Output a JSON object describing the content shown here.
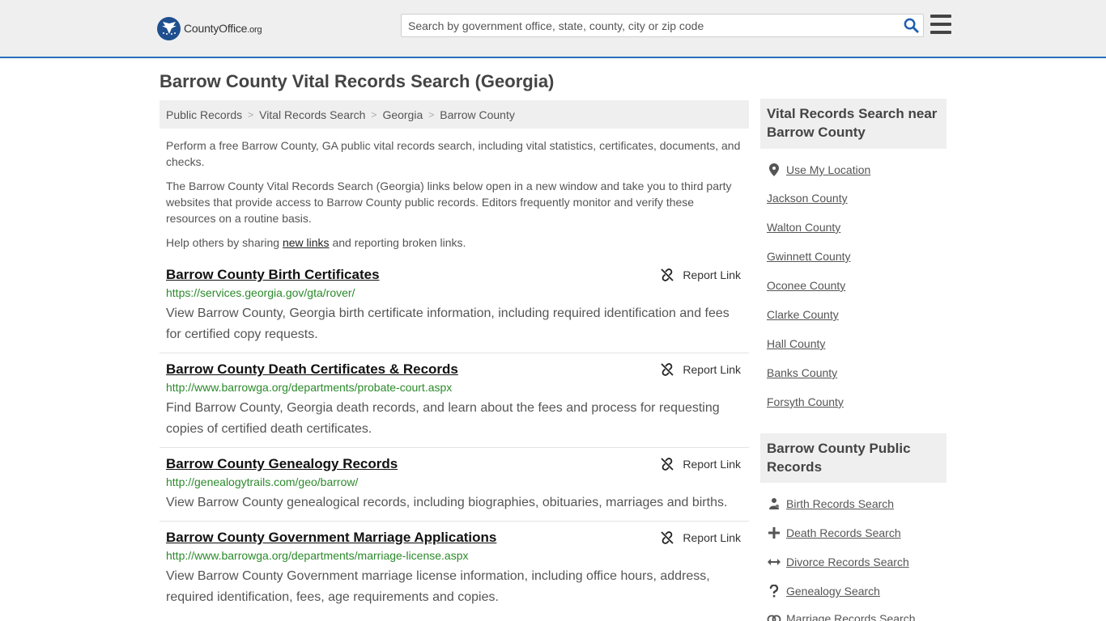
{
  "header": {
    "logo_text": "CountyOffice",
    "logo_tld": ".org",
    "search_placeholder": "Search by government office, state, county, city or zip code"
  },
  "page_title": "Barrow County Vital Records Search (Georgia)",
  "breadcrumb": [
    "Public Records",
    "Vital Records Search",
    "Georgia",
    "Barrow County"
  ],
  "intro": {
    "p1": "Perform a free Barrow County, GA public vital records search, including vital statistics, certificates, documents, and checks.",
    "p2": "The Barrow County Vital Records Search (Georgia) links below open in a new window and take you to third party websites that provide access to Barrow County public records. Editors frequently monitor and verify these resources on a routine basis.",
    "p3_before": "Help others by sharing ",
    "p3_link": "new links",
    "p3_after": " and reporting broken links."
  },
  "report_label": "Report Link",
  "records": [
    {
      "title": "Barrow County Birth Certificates",
      "url": "https://services.georgia.gov/gta/rover/",
      "desc": "View Barrow County, Georgia birth certificate information, including required identification and fees for certified copy requests."
    },
    {
      "title": "Barrow County Death Certificates & Records",
      "url": "http://www.barrowga.org/departments/probate-court.aspx",
      "desc": "Find Barrow County, Georgia death records, and learn about the fees and process for requesting copies of certified death certificates."
    },
    {
      "title": "Barrow County Genealogy Records",
      "url": "http://genealogytrails.com/geo/barrow/",
      "desc": "View Barrow County genealogical records, including biographies, obituaries, marriages and births."
    },
    {
      "title": "Barrow County Government Marriage Applications",
      "url": "http://www.barrowga.org/departments/marriage-license.aspx",
      "desc": "View Barrow County Government marriage license information, including office hours, address, required identification, fees, age requirements and copies."
    }
  ],
  "sidebar": {
    "nearby_heading": "Vital Records Search near Barrow County",
    "use_location": "Use My Location",
    "nearby": [
      "Jackson County",
      "Walton County",
      "Gwinnett County",
      "Oconee County",
      "Clarke County",
      "Hall County",
      "Banks County",
      "Forsyth County"
    ],
    "public_heading": "Barrow County Public Records",
    "public_links": [
      {
        "label": "Birth Records Search",
        "icon": "birth-icon"
      },
      {
        "label": "Death Records Search",
        "icon": "plus-icon"
      },
      {
        "label": "Divorce Records Search",
        "icon": "split-arrows-icon"
      },
      {
        "label": "Genealogy Search",
        "icon": "question-icon"
      },
      {
        "label": "Marriage Records Search",
        "icon": "rings-icon"
      }
    ]
  }
}
